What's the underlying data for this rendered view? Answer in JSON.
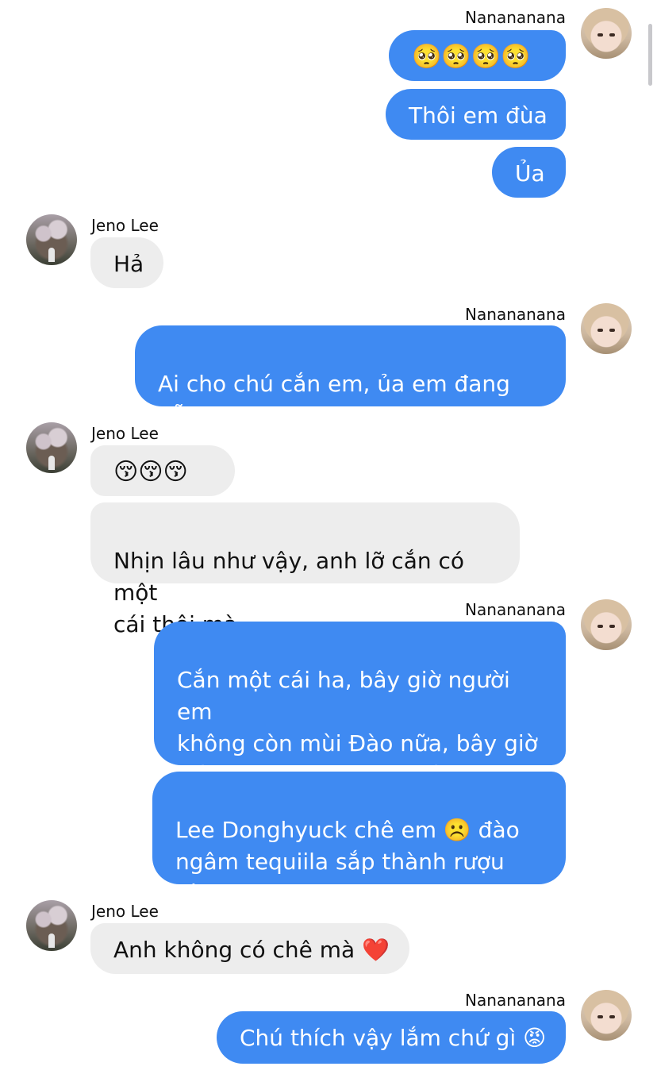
{
  "sender_me": "Nanananana",
  "sender_other": "Jeno Lee",
  "messages": [
    {
      "text": "🥺🥺🥺🥺"
    },
    {
      "text": "Thôi em đùa"
    },
    {
      "text": "Ủa"
    },
    {
      "text": "Hả"
    },
    {
      "text": "Ai cho chú cắn em, ủa em đang dỗi\nmà 😡"
    },
    {
      "text": "😚😚😚"
    },
    {
      "text": "Nhịn lâu như vậy, anh lỡ cắn có một\ncái thôi mà"
    },
    {
      "text": "Cắn một cái ha, bây giờ người em\nkhông còn mùi Đào nữa, bây giờ\nmùi đào bị loãng với mùi\nPheromone của chú mất rồi ☹️"
    },
    {
      "text": "Lee Donghyuck chê em ☹️ đào\nngâm tequiila sắp thành rượu đào\nmất rồi"
    },
    {
      "text": "Anh không có chê mà ❤️"
    },
    {
      "text": "Chú thích vậy lắm chứ gì 😡"
    }
  ],
  "colors": {
    "outgoing_bubble": "#3f8af2",
    "incoming_bubble": "#ededed"
  }
}
